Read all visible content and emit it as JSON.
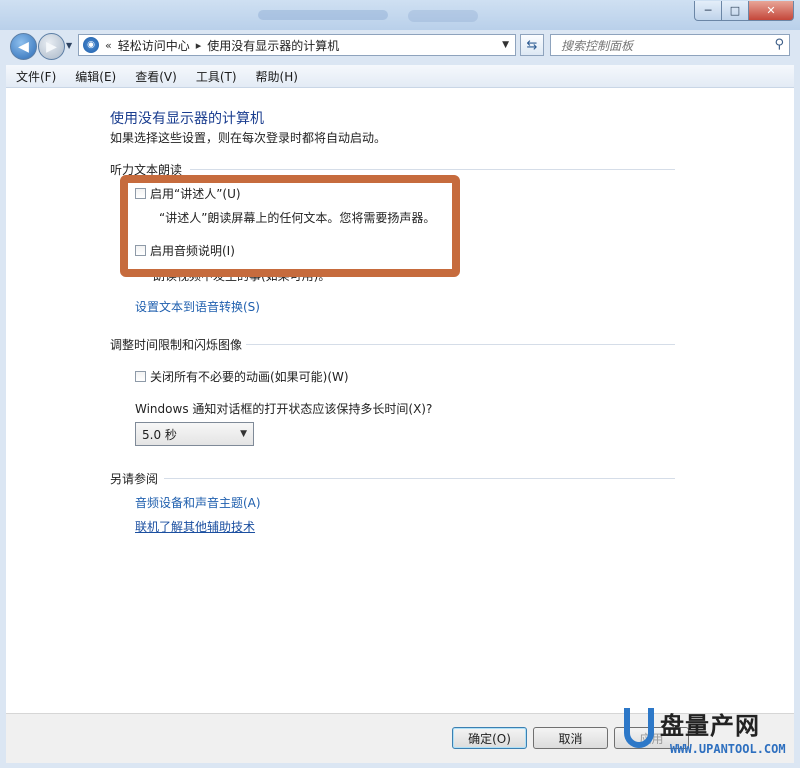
{
  "window": {
    "controls": {
      "min": "─",
      "max": "□",
      "close": "✕"
    }
  },
  "nav": {
    "back_icon": "◀",
    "forward_icon": "▶",
    "address": {
      "prefix": "«",
      "crumb1": "轻松访问中心",
      "sep": "▸",
      "crumb2": "使用没有显示器的计算机"
    },
    "search_placeholder": "搜索控制面板"
  },
  "menu": [
    "文件(F)",
    "编辑(E)",
    "查看(V)",
    "工具(T)",
    "帮助(H)"
  ],
  "page": {
    "title": "使用没有显示器的计算机",
    "subtitle": "如果选择这些设置，则在每次登录时都将自动启动。",
    "section1": {
      "heading": "听力文本朗读",
      "narrator_label": "启用“讲述人”(U)",
      "narrator_desc": "“讲述人”朗读屏幕上的任何文本。您将需要扬声器。",
      "audio_desc_label": "启用音频说明(I)",
      "audio_desc_text": "朗读视频中发生的事(如果可用)。",
      "tts_link": "设置文本到语音转换(S)"
    },
    "section2": {
      "heading": "调整时间限制和闪烁图像",
      "animations_label": "关闭所有不必要的动画(如果可能)(W)",
      "dialog_question": "Windows 通知对话框的打开状态应该保持多长时间(X)?",
      "duration_value": "5.0 秒"
    },
    "section3": {
      "heading": "另请参阅",
      "link1": "音频设备和声音主题(A)",
      "link2": "联机了解其他辅助技术"
    }
  },
  "buttons": {
    "ok": "确定(O)",
    "cancel": "取消",
    "apply": "应用"
  },
  "watermark": {
    "brand": "盘量产网",
    "url": "WWW.UPANTOOL.COM"
  },
  "colors": {
    "highlight_border": "#c66b3d",
    "link": "#1f5fae",
    "title": "#1a3d8f"
  }
}
